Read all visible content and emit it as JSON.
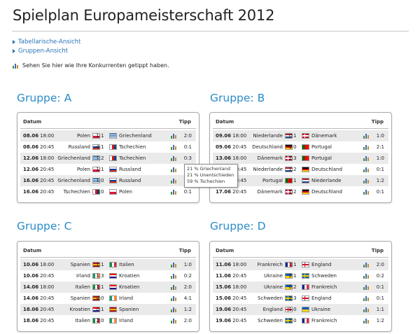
{
  "page": {
    "title": "Spielplan Europameisterschaft 2012"
  },
  "nav": [
    {
      "label": "Tabellarische-Ansicht"
    },
    {
      "label": "Gruppen-Ansicht"
    }
  ],
  "note": "Sehen Sie hier wie Ihre Konkurrenten getippt haben.",
  "headers": {
    "date": "Datum",
    "tip": "Tipp"
  },
  "groups": [
    {
      "title": "Gruppe: A",
      "matches": [
        {
          "date": "08.06",
          "time": "18:00",
          "home": "Polen",
          "score": "1:1",
          "away": "Griechenland",
          "tip": "2:0"
        },
        {
          "date": "08.06",
          "time": "20:45",
          "home": "Russland",
          "score": "4:1",
          "away": "Tschechien",
          "tip": "0:1"
        },
        {
          "date": "12.06",
          "time": "18:00",
          "home": "Griechenland",
          "score": "1:2",
          "away": "Tschechien",
          "tip": "0:3"
        },
        {
          "date": "12.06",
          "time": "20:45",
          "home": "Polen",
          "score": "1:1",
          "away": "Russland",
          "tip": "1:0"
        },
        {
          "date": "16.06",
          "time": "20:45",
          "home": "Griechenland",
          "score": "1:0",
          "away": "Russland",
          "tip": "1:2"
        },
        {
          "date": "16.06",
          "time": "20:45",
          "home": "Tschechien",
          "score": "1:0",
          "away": "Polen",
          "tip": "0:1"
        }
      ]
    },
    {
      "title": "Gruppe: B",
      "matches": [
        {
          "date": "09.06",
          "time": "18:00",
          "home": "Niederlande",
          "score": "0:1",
          "away": "Dänemark",
          "tip": "1:0"
        },
        {
          "date": "09.06",
          "time": "20:45",
          "home": "Deutschland",
          "score": "1:0",
          "away": "Portugal",
          "tip": "2:1"
        },
        {
          "date": "13.06",
          "time": "18:00",
          "home": "Dänemark",
          "score": "2:3",
          "away": "Portugal",
          "tip": "1:0"
        },
        {
          "date": "13.06",
          "time": "20:45",
          "home": "Niederlande",
          "score": "1:2",
          "away": "Deutschland",
          "tip": "0:1"
        },
        {
          "date": "17.06",
          "time": "20:45",
          "home": "Portugal",
          "score": "2:1",
          "away": "Niederlande",
          "tip": "1:2"
        },
        {
          "date": "17.06",
          "time": "20:45",
          "home": "Dänemark",
          "score": "1:2",
          "away": "Deutschland",
          "tip": "0:1"
        }
      ]
    },
    {
      "title": "Gruppe: C",
      "matches": [
        {
          "date": "10.06",
          "time": "18:00",
          "home": "Spanien",
          "score": "1:1",
          "away": "Italien",
          "tip": "1:0"
        },
        {
          "date": "10.06",
          "time": "20:45",
          "home": "Irland",
          "score": "1:3",
          "away": "Kroatien",
          "tip": "0:2"
        },
        {
          "date": "14.06",
          "time": "18:00",
          "home": "Italien",
          "score": "1:1",
          "away": "Kroatien",
          "tip": "2:0"
        },
        {
          "date": "14.06",
          "time": "20:45",
          "home": "Spanien",
          "score": "4:0",
          "away": "Irland",
          "tip": "4:1"
        },
        {
          "date": "18.06",
          "time": "20:45",
          "home": "Kroatien",
          "score": "0:1",
          "away": "Spanien",
          "tip": "1:2"
        },
        {
          "date": "18.06",
          "time": "20:45",
          "home": "Italien",
          "score": "2:0",
          "away": "Irland",
          "tip": "2:0"
        }
      ]
    },
    {
      "title": "Gruppe: D",
      "matches": [
        {
          "date": "11.06",
          "time": "18:00",
          "home": "Frankreich",
          "score": "1:1",
          "away": "England",
          "tip": "2:0"
        },
        {
          "date": "11.06",
          "time": "20:45",
          "home": "Ukraine",
          "score": "2:1",
          "away": "Schweden",
          "tip": "0:2"
        },
        {
          "date": "15.06",
          "time": "18:00",
          "home": "Ukraine",
          "score": "0:2",
          "away": "Frankreich",
          "tip": "0:1"
        },
        {
          "date": "15.06",
          "time": "20:45",
          "home": "Schweden",
          "score": "2:3",
          "away": "England",
          "tip": "0:1"
        },
        {
          "date": "19.06",
          "time": "20:45",
          "home": "England",
          "score": "1:0",
          "away": "Ukraine",
          "tip": "1:1"
        },
        {
          "date": "19.06",
          "time": "20:45",
          "home": "Schweden",
          "score": "2:0",
          "away": "Frankreich",
          "tip": "1:2"
        }
      ]
    }
  ],
  "tooltip": {
    "lines": [
      "21 % Griechenland",
      "21 % Unentschieden",
      "59 % Tschechien"
    ]
  },
  "flags": {
    "Polen": [
      "#ffffff",
      "#dc143c"
    ],
    "Griechenland": [
      "#0d5eaf",
      "#ffffff"
    ],
    "Russland": [
      "#ffffff",
      "#0039a6",
      "#d52b1e"
    ],
    "Tschechien": [
      "#ffffff",
      "#d7141a",
      "#11457e"
    ],
    "Niederlande": [
      "#ae1c28",
      "#ffffff",
      "#21468b"
    ],
    "Dänemark": [
      "#c60c30",
      "#ffffff"
    ],
    "Deutschland": [
      "#000000",
      "#dd0000",
      "#ffce00"
    ],
    "Portugal": [
      "#006600",
      "#ff0000"
    ],
    "Spanien": [
      "#aa151b",
      "#f1bf00",
      "#aa151b"
    ],
    "Italien": [
      "#009246",
      "#ffffff",
      "#ce2b37"
    ],
    "Irland": [
      "#169b62",
      "#ffffff",
      "#ff883e"
    ],
    "Kroatien": [
      "#ff0000",
      "#ffffff",
      "#171796"
    ],
    "Frankreich": [
      "#002395",
      "#ffffff",
      "#ed2939"
    ],
    "England": [
      "#ffffff",
      "#cf142b"
    ],
    "Ukraine": [
      "#0057b7",
      "#ffd700"
    ],
    "Schweden": [
      "#006aa7",
      "#fecc00"
    ]
  },
  "colors": {
    "accent": "#2a8cc8",
    "link": "#2a73b8",
    "alt_row": "#eaeaea"
  }
}
